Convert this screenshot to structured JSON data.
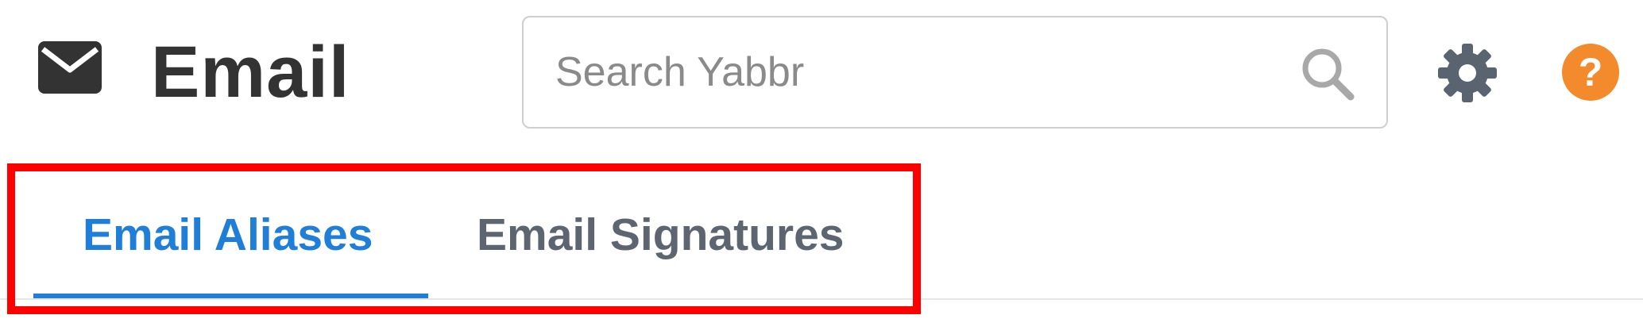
{
  "header": {
    "title": "Email",
    "icon": "envelope-icon"
  },
  "search": {
    "placeholder": "Search Yabbr",
    "value": "",
    "icon": "search-icon"
  },
  "toolbar": {
    "settings_icon": "gear-icon",
    "help_icon": "help-icon",
    "help_glyph": "?"
  },
  "tabs": [
    {
      "label": "Email Aliases",
      "active": true
    },
    {
      "label": "Email Signatures",
      "active": false
    }
  ],
  "colors": {
    "accent": "#1f7fd8",
    "inactive_tab": "#5d6670",
    "title_text": "#333333",
    "help_badge": "#f38b2c",
    "icon_gray": "#5a6470",
    "highlight": "#ff0000"
  }
}
